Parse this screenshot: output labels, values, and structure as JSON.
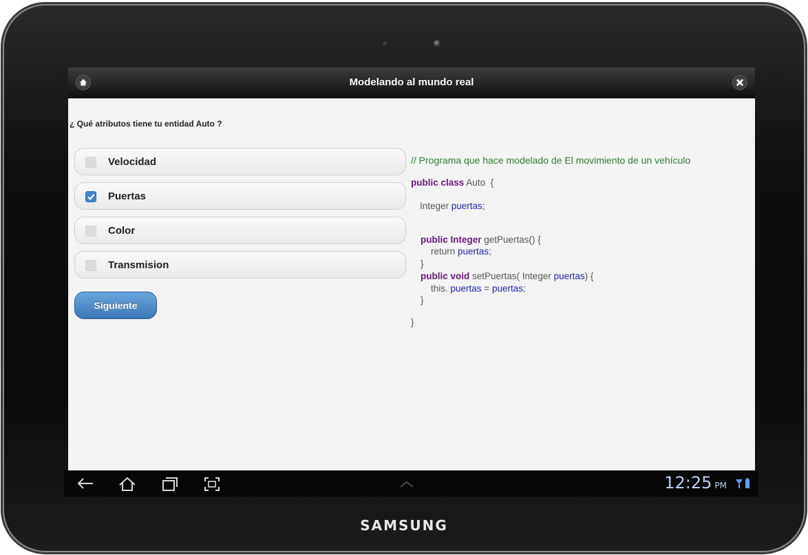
{
  "device": {
    "brand": "SAMSUNG"
  },
  "header": {
    "title": "Modelando al mundo real",
    "home_icon": "home-icon",
    "close_icon": "close-icon"
  },
  "question": "¿ Qué atributos tiene tu entidad Auto ?",
  "options": [
    {
      "label": "Velocidad",
      "checked": false
    },
    {
      "label": "Puertas",
      "checked": true
    },
    {
      "label": "Color",
      "checked": false
    },
    {
      "label": "Transmision",
      "checked": false
    }
  ],
  "next_button": "Siguiente",
  "code": {
    "comment": "// Programa que hace modelado de El movimiento de un vehículo",
    "class_kw": "public class",
    "class_name": " Auto  {",
    "field_type": "Integer ",
    "field_name": "puertas",
    "field_end": ";",
    "getter_kw": "public Integer",
    "getter_sig": " getPuertas() {",
    "return_kw": "return ",
    "return_var": "puertas",
    "return_end": ";",
    "brace_close": "}",
    "setter_kw": "public void",
    "setter_sig": " setPuertas( Integer ",
    "setter_param": "puertas",
    "setter_end": ") {",
    "this_kw": "this. ",
    "assign_left": "puertas",
    "assign_op": " = ",
    "assign_right": "puertas",
    "assign_end": ";",
    "class_close": "}"
  },
  "status_bar": {
    "time": "12:25",
    "ampm": "PM"
  },
  "colors": {
    "accent": "#3d87cb",
    "keyword": "#6b1a7a",
    "variable": "#2424b8",
    "comment": "#2e7d32"
  }
}
